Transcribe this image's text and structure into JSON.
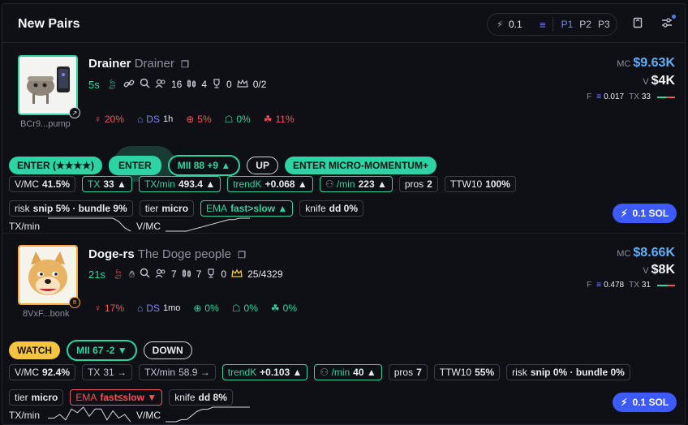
{
  "header": {
    "title": "New Pairs",
    "amount": "0.1",
    "presets": [
      "P1",
      "P2",
      "P3"
    ],
    "active_preset": "P1"
  },
  "colors": {
    "accent_green": "#2ed3a3",
    "accent_red": "#f2545b",
    "accent_blue": "#7d84f5",
    "accent_yellow": "#f5c542",
    "mc_blue": "#5fb0ff",
    "sol_button": "#3d5afe"
  },
  "pairs": [
    {
      "name": "Drainer",
      "subname": "Drainer",
      "address": "BCr9...pump",
      "age": "5s",
      "holders": "16",
      "pro_traders": "4",
      "trophy": "0",
      "top10": "0/2",
      "chips": {
        "top_holder": "20%",
        "ds_label": "DS",
        "ds_age": "1h",
        "snipers": "5%",
        "insiders": "0%",
        "bundles": "11%"
      },
      "mc_label": "MC",
      "mc": "$9.63K",
      "vol_label": "V",
      "vol": "$4K",
      "fee_label": "F",
      "fee": "0.017",
      "tx_label": "TX",
      "tx": "33",
      "buy_ratio": 0.55,
      "actions": [
        "ENTER  (★★★★)",
        "ENTER",
        "MII  88   +9 ▲",
        "UP",
        "ENTER MICRO-MOMENTUM+"
      ],
      "tags_row1": [
        {
          "k": "V/MC",
          "v": "41.5%"
        },
        {
          "k": "TX",
          "v": "33 ▲"
        },
        {
          "k": "TX/min",
          "v": "493.4 ▲"
        },
        {
          "k": "trendK",
          "v": "+0.068 ▲"
        },
        {
          "k": "/min",
          "v": "223 ▲"
        },
        {
          "k": "pros",
          "v": "2"
        },
        {
          "k": "TTW10",
          "v": "100%"
        }
      ],
      "tags_row2": [
        {
          "k": "risk",
          "v": "snip 5% · bundle 9%"
        },
        {
          "k": "tier",
          "v": "micro"
        },
        {
          "k": "EMA",
          "v": "fast>slow ▲"
        },
        {
          "k": "knife",
          "v": "dd 0%"
        }
      ],
      "spark_labels": [
        "TX/min",
        "V/MC"
      ],
      "spark_txmin": [
        4,
        4,
        4,
        4,
        4,
        4,
        4,
        4,
        4,
        4,
        4,
        4,
        3,
        1,
        0
      ],
      "spark_vmc": [
        0,
        0,
        0,
        0,
        0,
        1,
        2,
        3,
        4,
        5,
        6,
        7,
        8,
        8,
        9,
        9,
        9
      ],
      "sol": "0.1 SOL"
    },
    {
      "name": "Doge-rs",
      "subname": "The Doge people",
      "address": "8VxF...bonk",
      "age": "21s",
      "holders": "7",
      "pro_traders": "7",
      "trophy": "0",
      "top10": "25/4329",
      "chips": {
        "top_holder": "17%",
        "ds_label": "DS",
        "ds_age": "1mo",
        "snipers": "0%",
        "insiders": "0%",
        "bundles": "0%"
      },
      "mc_label": "MC",
      "mc": "$8.66K",
      "vol_label": "V",
      "vol": "$8K",
      "fee_label": "F",
      "fee": "0.478",
      "tx_label": "TX",
      "tx": "31",
      "buy_ratio": 0.6,
      "actions": [
        "WATCH",
        "MII  67  -2 ▼",
        "DOWN"
      ],
      "tags_row1": [
        {
          "k": "V/MC",
          "v": "92.4%"
        },
        {
          "k": "TX",
          "v": "31 →"
        },
        {
          "k": "TX/min",
          "v": "58.9 →"
        },
        {
          "k": "trendK",
          "v": "+0.103 ▲"
        },
        {
          "k": "/min",
          "v": "40 ▲"
        },
        {
          "k": "pros",
          "v": "7"
        },
        {
          "k": "TTW10",
          "v": "55%"
        },
        {
          "k": "risk",
          "v": "snip 0% · bundle 0%"
        }
      ],
      "tags_row2": [
        {
          "k": "tier",
          "v": "micro"
        },
        {
          "k": "EMA",
          "v": "fast≤slow ▼"
        },
        {
          "k": "knife",
          "v": "dd 8%"
        }
      ],
      "spark_labels": [
        "TX/min",
        "V/MC"
      ],
      "spark_txmin": [
        3,
        3,
        5,
        2,
        8,
        6,
        9,
        4,
        8,
        8,
        2,
        7,
        3,
        5,
        1
      ],
      "spark_vmc": [
        2,
        2,
        2,
        3,
        3,
        5,
        7,
        8,
        8,
        9,
        9,
        9,
        9,
        9,
        9,
        9,
        9
      ],
      "sol": "0.1 SOL"
    }
  ]
}
